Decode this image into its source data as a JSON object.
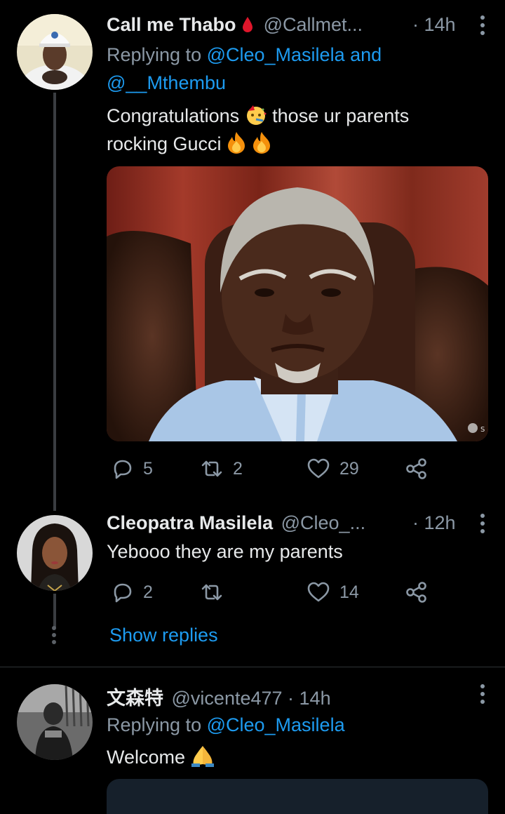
{
  "tweet1": {
    "name": "Call me Thabo",
    "handle": "@Callmet...",
    "time": "· 14h",
    "replying_prefix": "Replying to ",
    "reply_to_1": "@Cleo_Masilela and",
    "reply_to_2": "@__Mthembu",
    "text_line1_a": "Congratulations",
    "text_line1_b": "those ur parents",
    "text_line2": "rocking Gucci",
    "watermark": "S",
    "stats": {
      "replies": "5",
      "retweets": "2",
      "likes": "29"
    }
  },
  "tweet2": {
    "name": "Cleopatra Masilela",
    "handle": "@Cleo_...",
    "time": "· 12h",
    "text": "Yebooo they are my parents",
    "stats": {
      "replies": "2",
      "retweets": "",
      "likes": "14"
    }
  },
  "show_replies": "Show replies",
  "tweet3": {
    "name": "文森特",
    "handle": "@vicente477",
    "time": "· 14h",
    "replying_prefix": "Replying to ",
    "reply_to": "@Cleo_Masilela",
    "text": "Welcome"
  },
  "colors": {
    "link": "#1d9bf0",
    "muted": "#8b98a5",
    "background": "#000000"
  },
  "icons": [
    "reply-icon",
    "retweet-icon",
    "like-icon",
    "share-icon",
    "more-icon",
    "blood-drop-icon",
    "party-face-icon",
    "fire-icon",
    "praying-hands-icon"
  ]
}
